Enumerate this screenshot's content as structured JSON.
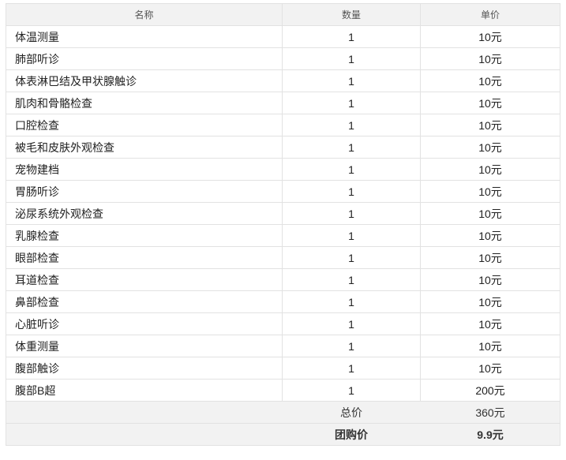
{
  "table": {
    "headers": {
      "name": "名称",
      "quantity": "数量",
      "unit_price": "单价"
    },
    "rows": [
      {
        "name": "体温测量",
        "quantity": "1",
        "price": "10元"
      },
      {
        "name": "肺部听诊",
        "quantity": "1",
        "price": "10元"
      },
      {
        "name": "体表淋巴结及甲状腺触诊",
        "quantity": "1",
        "price": "10元"
      },
      {
        "name": "肌肉和骨骼检查",
        "quantity": "1",
        "price": "10元"
      },
      {
        "name": "口腔检查",
        "quantity": "1",
        "price": "10元"
      },
      {
        "name": "被毛和皮肤外观检查",
        "quantity": "1",
        "price": "10元"
      },
      {
        "name": "宠物建档",
        "quantity": "1",
        "price": "10元"
      },
      {
        "name": "胃肠听诊",
        "quantity": "1",
        "price": "10元"
      },
      {
        "name": "泌尿系统外观检查",
        "quantity": "1",
        "price": "10元"
      },
      {
        "name": "乳腺检查",
        "quantity": "1",
        "price": "10元"
      },
      {
        "name": "眼部检查",
        "quantity": "1",
        "price": "10元"
      },
      {
        "name": "耳道检查",
        "quantity": "1",
        "price": "10元"
      },
      {
        "name": "鼻部检查",
        "quantity": "1",
        "price": "10元"
      },
      {
        "name": "心脏听诊",
        "quantity": "1",
        "price": "10元"
      },
      {
        "name": "体重测量",
        "quantity": "1",
        "price": "10元"
      },
      {
        "name": "腹部触诊",
        "quantity": "1",
        "price": "10元"
      },
      {
        "name": "腹部B超",
        "quantity": "1",
        "price": "200元"
      }
    ],
    "summary": {
      "total_label": "总价",
      "total_value": "360元",
      "group_label": "团购价",
      "group_value": "9.9元"
    }
  }
}
